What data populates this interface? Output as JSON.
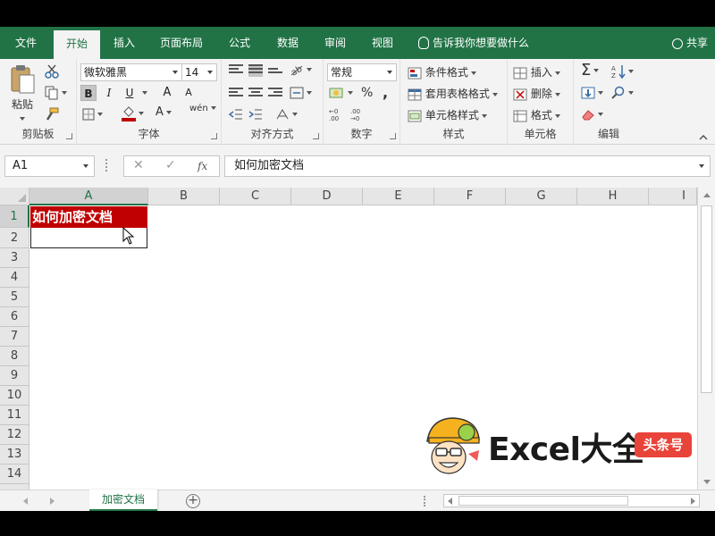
{
  "tabs": [
    {
      "label": "文件",
      "active": false
    },
    {
      "label": "开始",
      "active": true
    },
    {
      "label": "插入",
      "active": false
    },
    {
      "label": "页面布局",
      "active": false
    },
    {
      "label": "公式",
      "active": false
    },
    {
      "label": "数据",
      "active": false
    },
    {
      "label": "审阅",
      "active": false
    },
    {
      "label": "视图",
      "active": false
    }
  ],
  "tell_me": "告诉我你想要做什么",
  "share": "共享",
  "ribbon": {
    "clipboard": {
      "label": "剪贴板",
      "paste": "粘贴"
    },
    "font": {
      "label": "字体",
      "name": "微软雅黑",
      "size": "14",
      "bold": "B",
      "italic": "I",
      "underline": "U",
      "grow": "A",
      "shrink": "A",
      "color_letter": "A",
      "phonetic": "wén"
    },
    "alignment": {
      "label": "对齐方式"
    },
    "number": {
      "label": "数字",
      "format": "常规",
      "percent": "%",
      "comma": ","
    },
    "styles": {
      "label": "样式",
      "conditional": "条件格式",
      "table": "套用表格格式",
      "cell": "单元格样式"
    },
    "cells": {
      "label": "单元格",
      "insert": "插入",
      "delete": "删除",
      "format": "格式"
    },
    "editing": {
      "label": "编辑",
      "sum": "Σ"
    }
  },
  "formula_bar": {
    "name_box": "A1",
    "fx": "fx",
    "value": "如何加密文档"
  },
  "columns": [
    "A",
    "B",
    "C",
    "D",
    "E",
    "F",
    "G",
    "H",
    "I"
  ],
  "rows": [
    "1",
    "2",
    "3",
    "4",
    "5",
    "6",
    "7",
    "8",
    "9",
    "10",
    "11",
    "12",
    "13",
    "14"
  ],
  "cells": {
    "A1": "如何加密文档"
  },
  "sheet_tab": "加密文档",
  "watermark": {
    "text": "Excel大全",
    "badge": "头条号"
  },
  "colors": {
    "accent": "#217346",
    "cell_fill": "#c00000",
    "badge": "#e8443a"
  }
}
